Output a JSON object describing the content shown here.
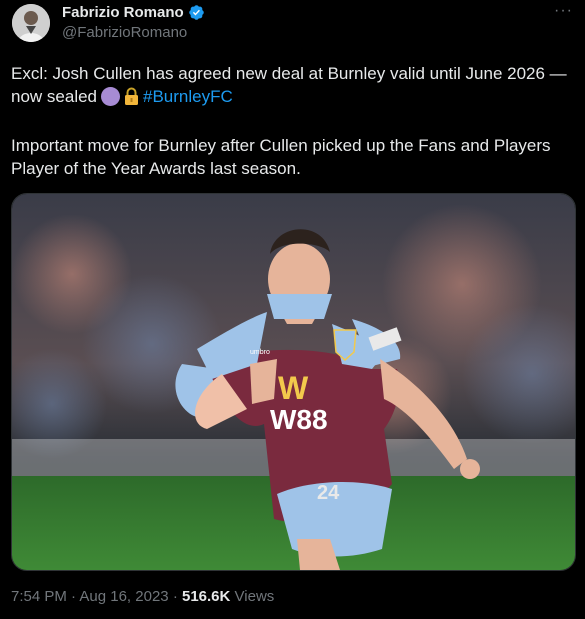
{
  "author": {
    "name": "Fabrizio Romano",
    "handle": "@FabrizioRomano",
    "verified": true
  },
  "more_label": "···",
  "tweet": {
    "line1": "Excl: Josh Cullen has agreed new deal at Burnley valid until June 2026 — now sealed",
    "hashtag": "#BurnleyFC",
    "paragraph2": "Important move for Burnley after Cullen picked up the Fans and Players Player of the Year Awards last season."
  },
  "media": {
    "shirt_sponsor": "W88",
    "shirt_number": "24",
    "shirt_brand": "umbro",
    "captain_band": "captain"
  },
  "meta": {
    "time": "7:54 PM",
    "date": "Aug 16, 2023",
    "views_count": "516.6K",
    "views_label": "Views"
  },
  "colors": {
    "accent": "#1d9bf0",
    "muted": "#71767b",
    "background": "#000000",
    "claret": "#7a2a3e",
    "sky_blue": "#9fc3e8"
  }
}
